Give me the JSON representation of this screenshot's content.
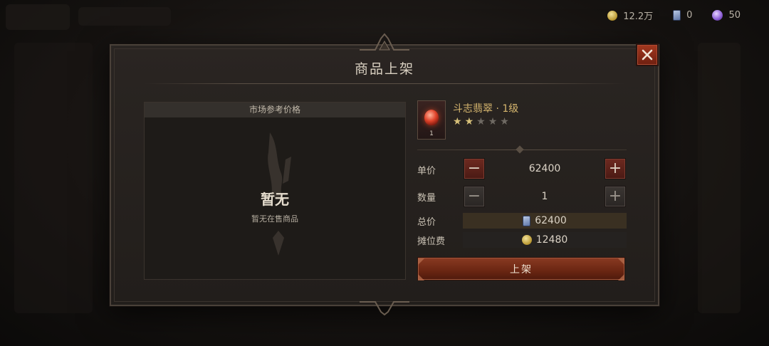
{
  "currency": {
    "gold": "12.2万",
    "cards": "0",
    "orbs": "50"
  },
  "dialog": {
    "title": "商品上架",
    "close_icon": "close-icon"
  },
  "market": {
    "header": "市场参考价格",
    "empty_title": "暂无",
    "empty_subtitle": "暂无在售商品"
  },
  "item": {
    "name": "斗志翡翠 · 1级",
    "quantity_badge": "1",
    "stars_filled": 2,
    "stars_total": 5,
    "icon": "red-gem-icon"
  },
  "form": {
    "unit_price_label": "单价",
    "unit_price_value": "62400",
    "quantity_label": "数量",
    "quantity_value": "1",
    "total_label": "总价",
    "total_value": "62400",
    "fee_label": "摊位费",
    "fee_value": "12480",
    "decrement_symbol": "−",
    "increment_symbol": "+"
  },
  "submit": {
    "label": "上架"
  },
  "colors": {
    "accent_red": "#8a3a22",
    "gold_text": "#d6b66e"
  }
}
